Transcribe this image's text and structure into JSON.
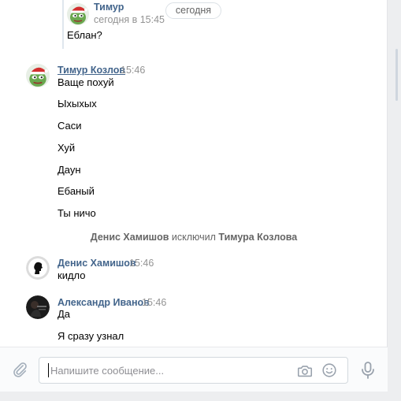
{
  "forwarded": {
    "author": "Тимур",
    "time": "сегодня в 15:45",
    "text": "Еблан?"
  },
  "date_divider": "сегодня",
  "groups": [
    {
      "author": "Тимур Козлов",
      "time": "15:46",
      "messages": [
        "Ваще похуй",
        "Ыхыхых",
        "Саси",
        "Хуй",
        "Даун",
        "Ебаный",
        "Ты ничо"
      ]
    },
    {
      "author": "Денис Хамишов",
      "time": "15:46",
      "messages": [
        "кидло"
      ]
    },
    {
      "author": "Александр Иванов",
      "time": "15:46",
      "messages": [
        "Да",
        "Я сразу узнал"
      ]
    }
  ],
  "service_message": {
    "actor": "Денис Хамишов",
    "action": "исключил",
    "target": "Тимура Козлова"
  },
  "composer": {
    "placeholder": "Напишите сообщение..."
  },
  "icons": {
    "attach": "paperclip-icon",
    "camera": "camera-icon",
    "emoji": "smile-icon",
    "voice": "microphone-icon"
  },
  "colors": {
    "link": "#42648b",
    "muted": "#939393",
    "border": "#dce1e6"
  }
}
